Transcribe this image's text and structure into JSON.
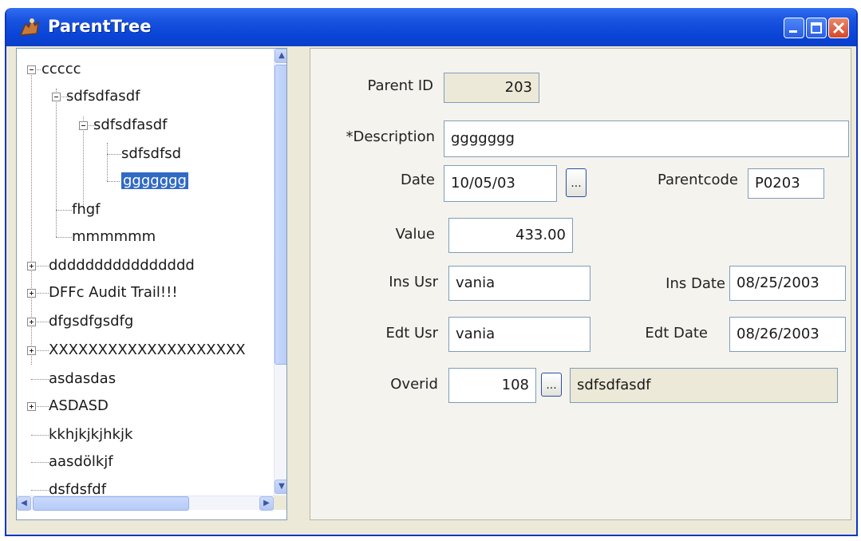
{
  "window": {
    "title": "ParentTree"
  },
  "tree": {
    "nodes": [
      {
        "label": "ccccc",
        "expander": "minus"
      },
      {
        "label": "sdfsdfasdf",
        "expander": "minus"
      },
      {
        "label": "sdfsdfasdf",
        "expander": "minus"
      },
      {
        "label": "sdfsdfsd"
      },
      {
        "label": "ggggggg",
        "selected": true
      },
      {
        "label": "fhgf"
      },
      {
        "label": "mmmmmm"
      },
      {
        "label": "dddddddddddddddd",
        "expander": "plus"
      },
      {
        "label": "DFFc Audit Trail!!!",
        "expander": "plus"
      },
      {
        "label": "dfgsdfgsdfg",
        "expander": "plus"
      },
      {
        "label": "XXXXXXXXXXXXXXXXXXXX",
        "expander": "plus"
      },
      {
        "label": "asdasdas"
      },
      {
        "label": "ASDASD",
        "expander": "plus"
      },
      {
        "label": "kkhjkjkjhkjk"
      },
      {
        "label": "aasdölkjf"
      },
      {
        "label": "dsfdsfdf"
      }
    ]
  },
  "form": {
    "parent_id": {
      "label": "Parent ID",
      "value": "203"
    },
    "description": {
      "label": "*Description",
      "value": "ggggggg"
    },
    "date": {
      "label": "Date",
      "value": "10/05/03",
      "button": "..."
    },
    "parentcode": {
      "label": "Parentcode",
      "value": "P0203"
    },
    "value": {
      "label": "Value",
      "value": "433.00"
    },
    "ins_usr": {
      "label": "Ins Usr",
      "value": "vania"
    },
    "ins_date": {
      "label": "Ins Date",
      "value": "08/25/2003"
    },
    "edt_usr": {
      "label": "Edt Usr",
      "value": "vania"
    },
    "edt_date": {
      "label": "Edt Date",
      "value": "08/26/2003"
    },
    "overid": {
      "label": "Overid",
      "value": "108",
      "button": "...",
      "description": "sdfsdfasdf"
    }
  },
  "colors": {
    "title_bar": "#0a45d8",
    "selection": "#316ac5",
    "readonly_field": "#ece9d8"
  },
  "icons": [
    "app-icon",
    "minimize-icon",
    "maximize-icon",
    "close-icon",
    "scroll-up-icon",
    "scroll-down-icon",
    "scroll-left-icon",
    "scroll-right-icon"
  ]
}
